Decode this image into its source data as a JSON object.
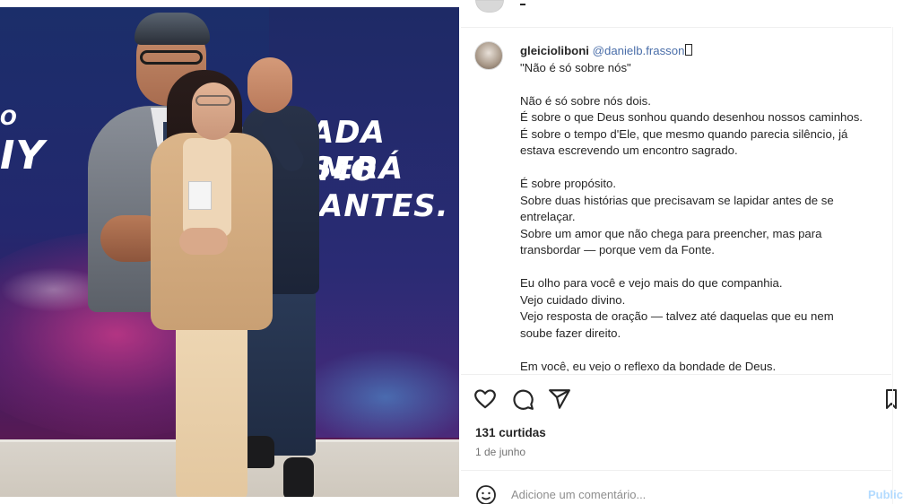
{
  "photo": {
    "banner_left_line1": "O",
    "banner_left_line2": "IY",
    "banner_right_line1": "ADA SERÁ",
    "banner_right_line2": "MO ANTES."
  },
  "post": {
    "username": "gleicioliboni",
    "mention": "@danielb.frasson",
    "caption_lines": [
      "\"Não é só sobre nós\"",
      "",
      "Não é só sobre nós dois.",
      "É sobre o que Deus sonhou quando desenhou nossos caminhos.",
      "É sobre o tempo d'Ele, que mesmo quando parecia silêncio, já",
      "estava escrevendo um encontro sagrado.",
      "",
      "É sobre propósito.",
      "Sobre duas histórias que precisavam se lapidar antes de se",
      "entrelaçar.",
      "Sobre um amor que não chega para preencher, mas para",
      "transbordar — porque vem da Fonte.",
      "",
      "Eu olho para você e vejo mais do que companhia.",
      "Vejo cuidado divino.",
      "Vejo resposta de oração — talvez até daquelas que eu nem",
      "soube fazer direito.",
      "",
      "Em você, eu vejo o reflexo da bondade de Deus."
    ],
    "likes": "131 curtidas",
    "date": "1 de junho",
    "comment_placeholder": "Adicione um comentário...",
    "publish_label": "Publicar"
  },
  "icons": {
    "like": "heart-icon",
    "comment": "comment-bubble-icon",
    "share": "paper-plane-icon",
    "save": "bookmark-icon",
    "emoji": "emoji-smile-icon"
  },
  "colors": {
    "text": "#262626",
    "mention": "#4a6ea9",
    "muted": "#737373",
    "publish": "#b3dbff"
  }
}
